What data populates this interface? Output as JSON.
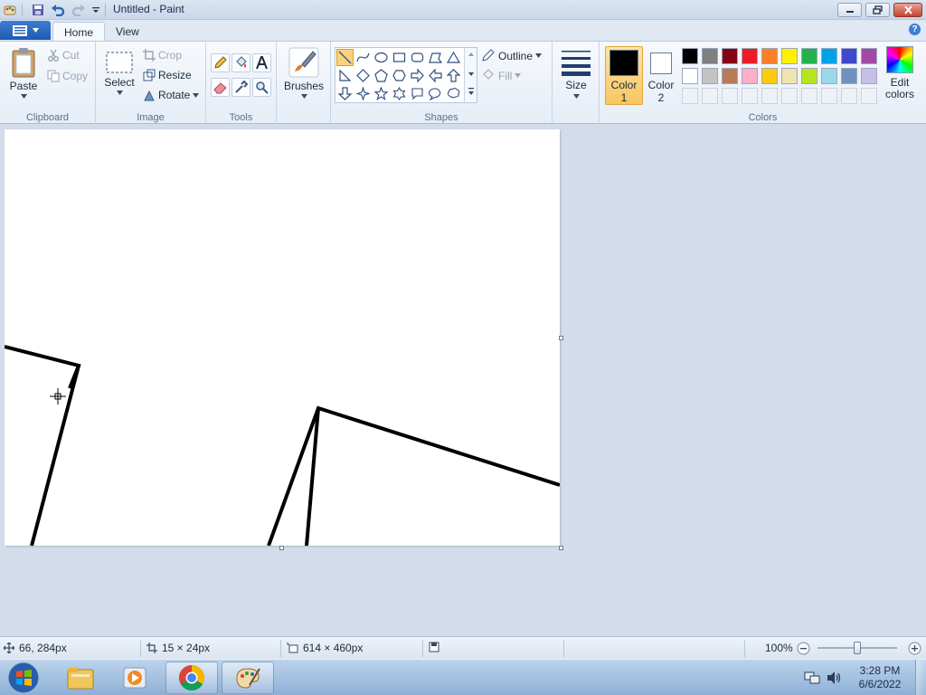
{
  "window": {
    "title": "Untitled - Paint"
  },
  "tabs": [
    {
      "label": "Home"
    },
    {
      "label": "View"
    }
  ],
  "help": {
    "label": "?"
  },
  "clipboard": {
    "paste": "Paste",
    "cut": "Cut",
    "copy": "Copy",
    "group": "Clipboard"
  },
  "image": {
    "select": "Select",
    "crop": "Crop",
    "resize": "Resize",
    "rotate": "Rotate",
    "group": "Image"
  },
  "tools": {
    "group": "Tools"
  },
  "brushes": {
    "label": "Brushes"
  },
  "shapes": {
    "outline": "Outline",
    "fill": "Fill",
    "group": "Shapes"
  },
  "size": {
    "label": "Size"
  },
  "colors": {
    "color1": "Color",
    "color1_num": "1",
    "color2": "Color",
    "color2_num": "2",
    "edit_line1": "Edit",
    "edit_line2": "colors",
    "group": "Colors",
    "color1_value": "#000000",
    "color2_value": "#ffffff",
    "palette_row1": [
      "#000000",
      "#7f7f7f",
      "#880015",
      "#ed1c24",
      "#ff7f27",
      "#fff200",
      "#22b14c",
      "#00a2e8",
      "#3f48cc",
      "#a349a4"
    ],
    "palette_row2": [
      "#ffffff",
      "#c3c3c3",
      "#b97a57",
      "#ffaec9",
      "#ffc90e",
      "#efe4b0",
      "#b5e61d",
      "#99d9ea",
      "#7092be",
      "#c8bfe7"
    ]
  },
  "status": {
    "cursor_pos": "66, 284px",
    "selection_size": "15 × 24px",
    "canvas_size": "614 × 460px",
    "zoom": "100%",
    "zoom_level": 1.0
  },
  "taskbar": {
    "time": "3:28 PM",
    "date": "6/6/2022"
  },
  "accent": "#1d5bb3"
}
